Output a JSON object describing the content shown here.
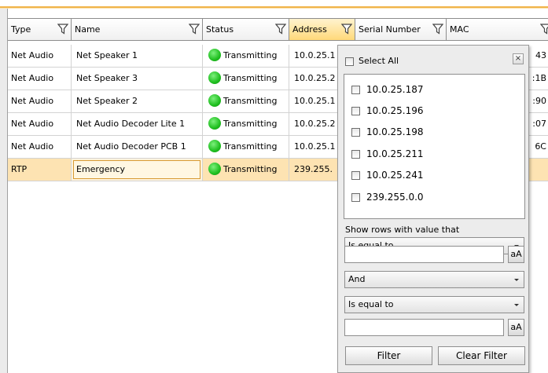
{
  "grid": {
    "columns": [
      {
        "label": "Type"
      },
      {
        "label": "Name"
      },
      {
        "label": "Status"
      },
      {
        "label": "Address"
      },
      {
        "label": "Serial Number"
      },
      {
        "label": "MAC"
      }
    ],
    "rows": [
      {
        "type": "Net Audio",
        "name": "Net Speaker 1",
        "status": "Transmitting",
        "address": "10.0.25.1",
        "mac": "43"
      },
      {
        "type": "Net Audio",
        "name": "Net Speaker 3",
        "status": "Transmitting",
        "address": "10.0.25.2",
        "mac": ":1B"
      },
      {
        "type": "Net Audio",
        "name": "Net Speaker 2",
        "status": "Transmitting",
        "address": "10.0.25.1",
        "mac": ":90"
      },
      {
        "type": "Net Audio",
        "name": "Net Audio Decoder Lite 1",
        "status": "Transmitting",
        "address": "10.0.25.2",
        "mac": ":07"
      },
      {
        "type": "Net Audio",
        "name": "Net Audio Decoder PCB 1",
        "status": "Transmitting",
        "address": "10.0.25.1",
        "mac": "6C"
      },
      {
        "type": "RTP",
        "name": "Emergency",
        "status": "Transmitting",
        "address": "239.255.",
        "mac": ""
      }
    ],
    "status_color": "#22c022",
    "accent_color": "#f0b44a"
  },
  "filter_popup": {
    "select_all_label": "Select All",
    "close_glyph": "×",
    "values": [
      "10.0.25.187",
      "10.0.25.196",
      "10.0.25.198",
      "10.0.25.211",
      "10.0.25.241",
      "239.255.0.0"
    ],
    "show_rows_label": "Show rows with value that",
    "operator1": "Is equal to",
    "value1": "",
    "case_label_1": "aA",
    "logic": "And",
    "operator2": "Is equal to",
    "value2": "",
    "case_label_2": "aA",
    "filter_button": "Filter",
    "clear_button": "Clear Filter"
  }
}
